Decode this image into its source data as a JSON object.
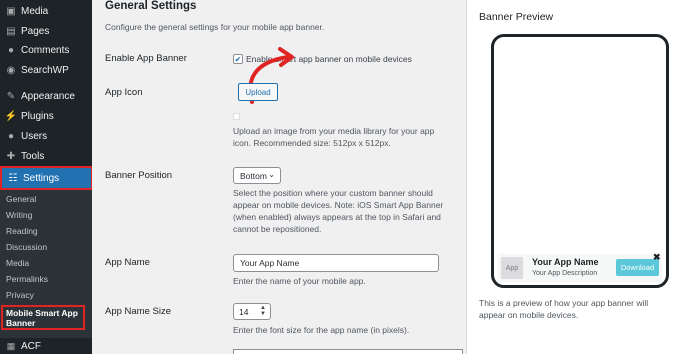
{
  "sidebar": {
    "items": [
      {
        "label": "Media",
        "icon": "media-icon"
      },
      {
        "label": "Pages",
        "icon": "pages-icon"
      },
      {
        "label": "Comments",
        "icon": "comments-icon"
      },
      {
        "label": "SearchWP",
        "icon": "searchwp-icon"
      },
      {
        "label": "Appearance",
        "icon": "appearance-icon"
      },
      {
        "label": "Plugins",
        "icon": "plugins-icon"
      },
      {
        "label": "Users",
        "icon": "users-icon"
      },
      {
        "label": "Tools",
        "icon": "tools-icon"
      },
      {
        "label": "Settings",
        "icon": "settings-icon"
      }
    ],
    "submenu": [
      "General",
      "Writing",
      "Reading",
      "Discussion",
      "Media",
      "Permalinks",
      "Privacy"
    ],
    "current_submenu": "Mobile Smart App Banner",
    "acf": "ACF"
  },
  "main": {
    "title": "General Settings",
    "intro": "Configure the general settings for your mobile app banner.",
    "enable_label": "Enable App Banner",
    "enable_checkbox_label": "Enable smart app banner on mobile devices",
    "enable_checked": true,
    "app_icon_label": "App Icon",
    "upload_button": "Upload",
    "app_icon_help": "Upload an image from your media library for your app icon. Recommended size: 512px x 512px.",
    "banner_position_label": "Banner Position",
    "banner_position_value": "Bottom",
    "banner_position_help": "Select the position where your custom banner should appear on mobile devices. Note: iOS Smart App Banner (when enabled) always appears at the top in Safari and cannot be repositioned.",
    "app_name_label": "App Name",
    "app_name_value": "Your App Name",
    "app_name_help": "Enter the name of your mobile app.",
    "app_name_size_label": "App Name Size",
    "app_name_size_value": "14",
    "app_name_size_help": "Enter the font size for the app name (in pixels)."
  },
  "preview": {
    "title": "Banner Preview",
    "app_icon_text": "App",
    "app_name": "Your App Name",
    "app_description": "Your App Description",
    "download_button": "Download",
    "close": "✖",
    "description": "This is a preview of how your app banner will appear on mobile devices."
  },
  "colors": {
    "admin_bar": "#1d2327",
    "accent": "#2271b1",
    "highlight": "#e02424",
    "download": "#5ac8d8"
  }
}
